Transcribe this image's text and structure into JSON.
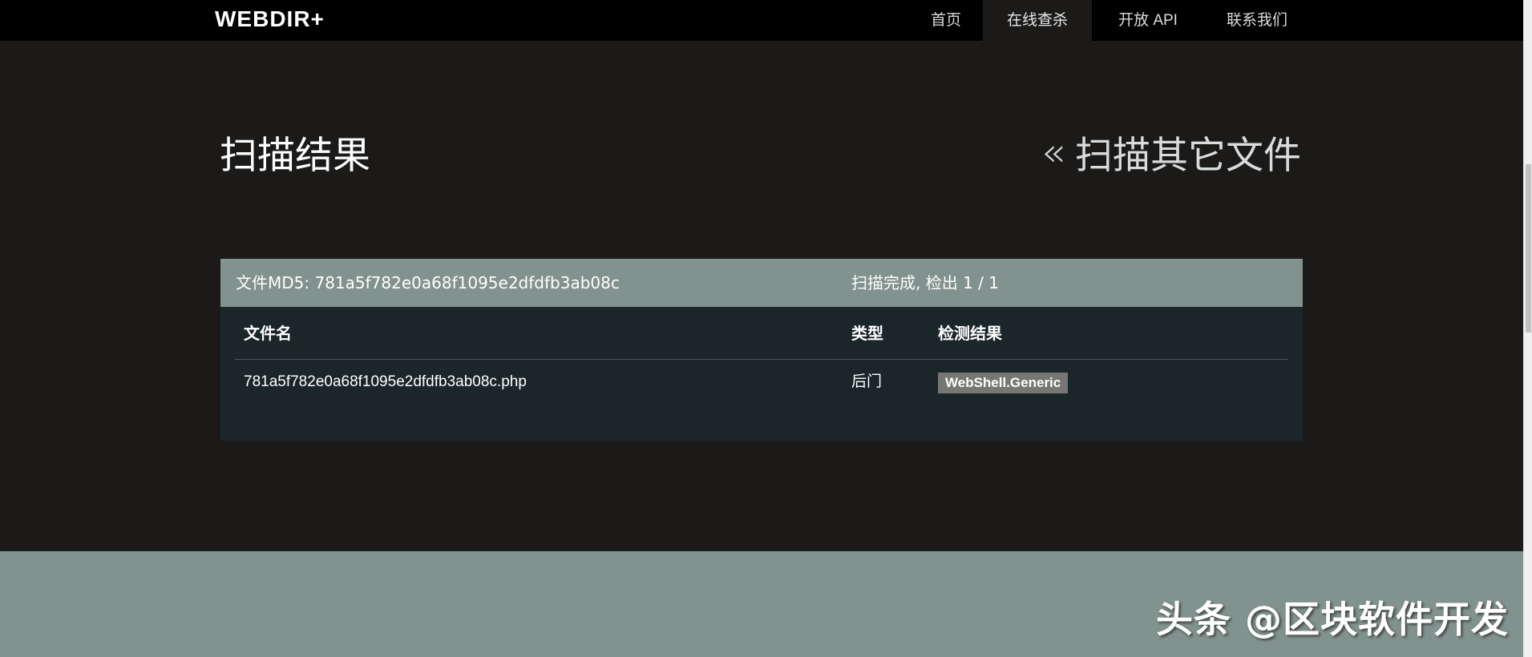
{
  "navbar": {
    "brand": "WEBDIR+",
    "items": [
      {
        "label": "首页",
        "active": false
      },
      {
        "label": "在线查杀",
        "active": true
      },
      {
        "label": "开放 API",
        "active": false
      },
      {
        "label": "联系我们",
        "active": false
      }
    ]
  },
  "header": {
    "title": "扫描结果",
    "back_arrow": "«",
    "back_label": "扫描其它文件"
  },
  "result": {
    "md5_label": "文件MD5: 781a5f782e0a68f1095e2dfdfb3ab08c",
    "status": "扫描完成, 检出 1 / 1",
    "columns": [
      "文件名",
      "类型",
      "检测结果"
    ],
    "rows": [
      {
        "filename": "781a5f782e0a68f1095e2dfdfb3ab08c.php",
        "type": "后门",
        "detection": "WebShell.Generic"
      }
    ]
  },
  "watermark": "头条 @区块软件开发",
  "colors": {
    "navbar_bg": "#000000",
    "page_bg": "#1b1a19",
    "panel_head_bg": "#82928e",
    "panel_body_bg": "#1b2629",
    "badge_bg": "#767672",
    "footer_bg": "#82928e"
  }
}
